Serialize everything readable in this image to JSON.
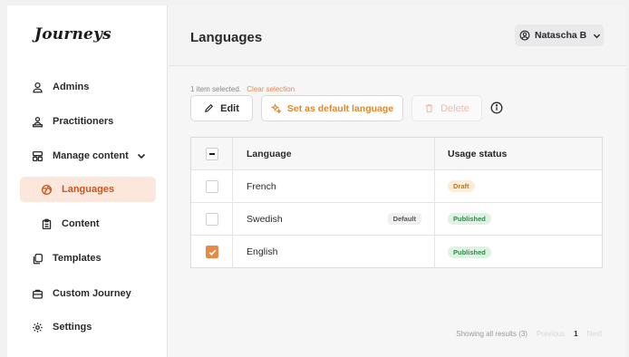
{
  "app": {
    "logo_text": "Journeys"
  },
  "sidebar": {
    "items": [
      {
        "label": "Admins",
        "icon": "user-icon"
      },
      {
        "label": "Practitioners",
        "icon": "users-icon"
      },
      {
        "label": "Manage content",
        "icon": "layout-icon",
        "expanded": true
      },
      {
        "label": "Languages",
        "icon": "globe-icon",
        "active": true
      },
      {
        "label": "Content",
        "icon": "clipboard-icon"
      },
      {
        "label": "Templates",
        "icon": "copy-icon"
      },
      {
        "label": "Custom Journey",
        "icon": "briefcase-icon"
      },
      {
        "label": "Settings",
        "icon": "gear-icon"
      }
    ]
  },
  "header": {
    "title": "Languages",
    "user_name": "Natascha B"
  },
  "selection": {
    "text": "1 item selected.",
    "clear_label": "Clear selection"
  },
  "toolbar": {
    "edit_label": "Edit",
    "set_default_label": "Set as default language",
    "delete_label": "Delete"
  },
  "table": {
    "headers": {
      "language": "Language",
      "status": "Usage status"
    },
    "rows": [
      {
        "language": "French",
        "status": "Draft",
        "default_tag": "",
        "checked": false
      },
      {
        "language": "Swedish",
        "status": "Published",
        "default_tag": "Default",
        "checked": false
      },
      {
        "language": "English",
        "status": "Published",
        "default_tag": "",
        "checked": true
      }
    ]
  },
  "pagination": {
    "summary": "Showing all results (3)",
    "prev": "Previous",
    "page": "1",
    "next": "Next"
  },
  "colors": {
    "accent": "#e68a45",
    "active_bg": "#fbe7dc",
    "draft_bg": "#fbedd8",
    "published_bg": "#dff3e4"
  }
}
